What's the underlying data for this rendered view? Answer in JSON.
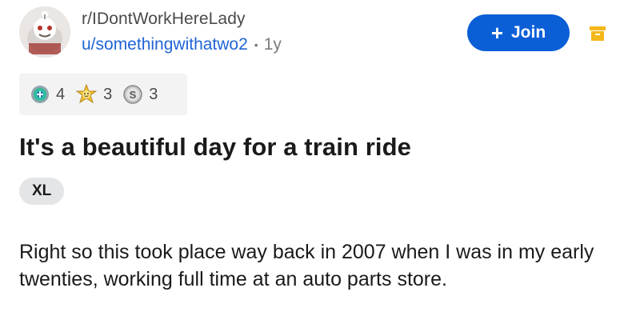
{
  "header": {
    "subreddit": "r/IDontWorkHereLady",
    "username": "u/somethingwithatwo2",
    "separator": "•",
    "age": "1y",
    "join_label": "Join",
    "join_icon": "plus",
    "save_icon": "archive-icon",
    "accent_color": "#0b5fd6",
    "username_color": "#1f64d6"
  },
  "awards": [
    {
      "icon": "helpful-award-icon",
      "count": "4"
    },
    {
      "icon": "wholesome-award-icon",
      "count": "3"
    },
    {
      "icon": "silver-award-icon",
      "count": "3"
    }
  ],
  "post": {
    "title": "It's a beautiful day for a train ride",
    "flair": "XL",
    "body": "Right so this took place way back in 2007 when I was in my early twenties, working full time at an auto parts store."
  }
}
